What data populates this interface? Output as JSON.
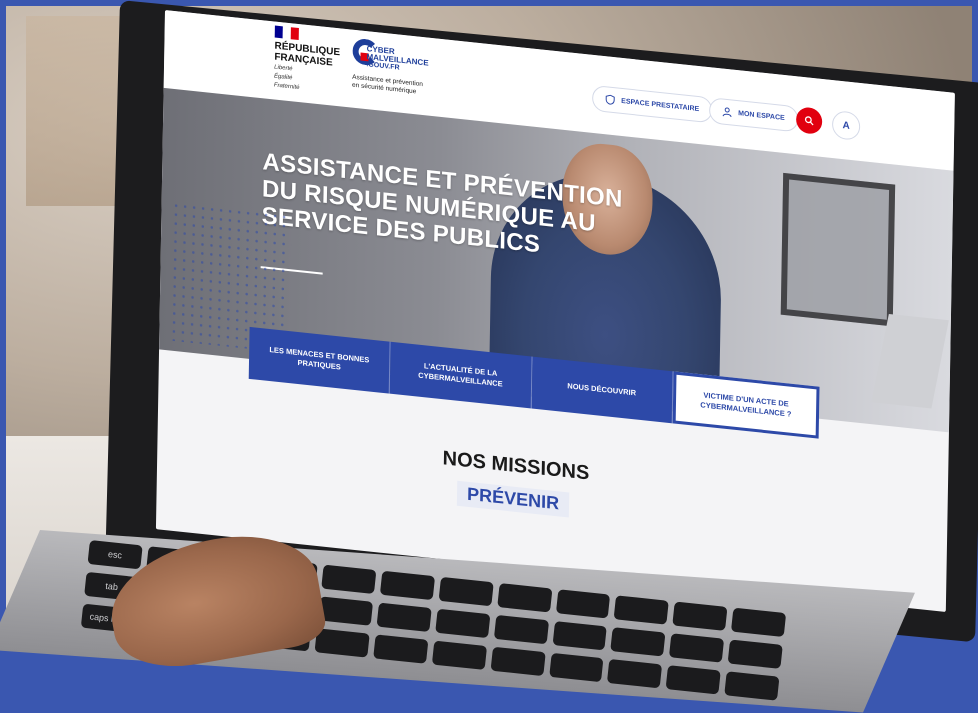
{
  "header": {
    "gov_logo": {
      "name_line1": "RÉPUBLIQUE",
      "name_line2": "FRANÇAISE",
      "motto_line1": "Liberté",
      "motto_line2": "Égalité",
      "motto_line3": "Fraternité"
    },
    "site_logo": {
      "title_line1": "CYBER",
      "title_line2": "MALVEILLANCE",
      "domain": ".GOUV.FR",
      "tagline_line1": "Assistance et prévention",
      "tagline_line2": "en sécurité numérique"
    },
    "buttons": {
      "prestataire": "ESPACE PRESTATAIRE",
      "mon_espace": "MON ESPACE",
      "accessibility": "A"
    }
  },
  "hero": {
    "title_line1": "ASSISTANCE ET PRÉVENTION",
    "title_line2": "DU RISQUE NUMÉRIQUE AU",
    "title_line3": "SERVICE DES PUBLICS"
  },
  "nav": {
    "menaces": "LES MENACES ET BONNES PRATIQUES",
    "actualite": "L'ACTUALITÉ DE LA CYBERMALVEILLANCE",
    "decouvrir": "NOUS DÉCOUVRIR",
    "victime": "VICTIME D'UN ACTE DE CYBERMALVEILLANCE ?"
  },
  "missions": {
    "title": "NOS MISSIONS",
    "subtitle": "PRÉVENIR"
  },
  "keyboard": {
    "keys": [
      "esc",
      "",
      "",
      "",
      "",
      "",
      "",
      "",
      "",
      "",
      "",
      "",
      "tab",
      "",
      "",
      "",
      "",
      "",
      "",
      "",
      "",
      "",
      "",
      "",
      "caps lock",
      "",
      "",
      "",
      "",
      "",
      "",
      "",
      "",
      "",
      "",
      ""
    ]
  },
  "colors": {
    "brand_blue": "#2d49a8",
    "alert_red": "#e1000f",
    "frame_blue": "#3a57b0"
  }
}
